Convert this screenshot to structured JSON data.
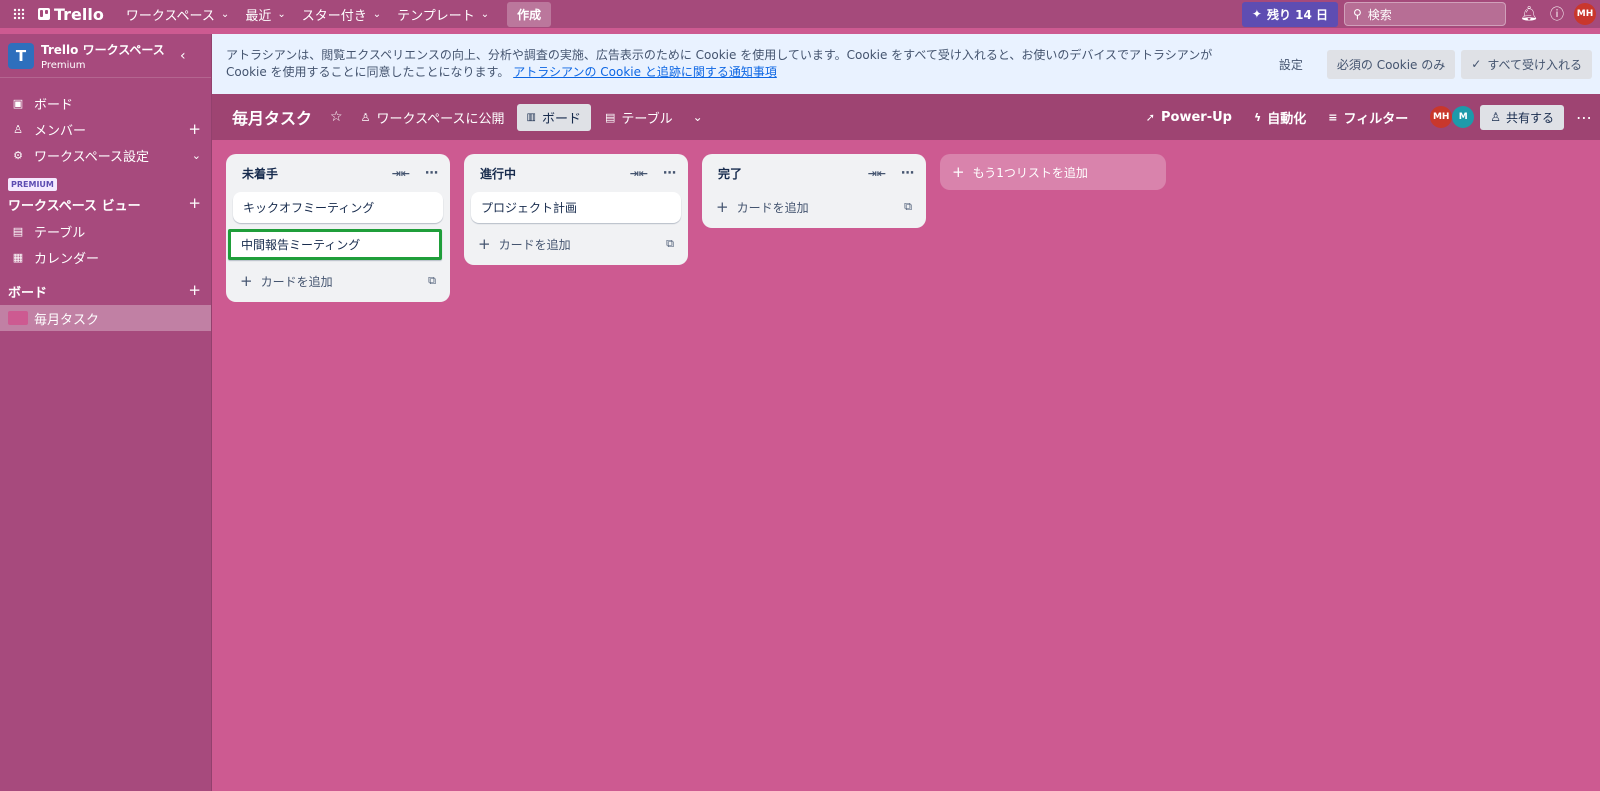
{
  "topbar": {
    "logo": "Trello",
    "menu": [
      {
        "label": "ワークスペース"
      },
      {
        "label": "最近"
      },
      {
        "label": "スター付き"
      },
      {
        "label": "テンプレート"
      }
    ],
    "create_label": "作成",
    "trial_label": "残り 14 日",
    "search_placeholder": "検索",
    "avatar_initials": "MH"
  },
  "sidebar": {
    "workspace_name": "Trello ワークスペース",
    "workspace_plan": "Premium",
    "workspace_initial": "T",
    "nav": [
      {
        "label": "ボード"
      },
      {
        "label": "メンバー"
      },
      {
        "label": "ワークスペース設定"
      }
    ],
    "premium_badge": "PREMIUM",
    "views_title": "ワークスペース ビュー",
    "views": [
      {
        "label": "テーブル"
      },
      {
        "label": "カレンダー"
      }
    ],
    "boards_title": "ボード",
    "boards": [
      {
        "label": "毎月タスク"
      }
    ]
  },
  "cookie": {
    "text": "アトラシアンは、閲覧エクスペリエンスの向上、分析や調査の実施、広告表示のために Cookie を使用しています。Cookie をすべて受け入れると、お使いのデバイスでアトラシアンが Cookie を使用することに同意したことになります。",
    "link": "アトラシアンの Cookie と追跡に関する通知事項",
    "settings_label": "設定",
    "necessary_label": "必須の Cookie のみ",
    "accept_all_label": "すべて受け入れる"
  },
  "board": {
    "title": "毎月タスク",
    "visibility": "ワークスペースに公開",
    "view_board": "ボード",
    "view_table": "テーブル",
    "powerup_label": "Power-Up",
    "automation_label": "自動化",
    "filter_label": "フィルター",
    "members": [
      {
        "initials": "MH",
        "color": "#c9372c"
      },
      {
        "initials": "M",
        "color": "#1d9aaa"
      }
    ],
    "share_label": "共有する",
    "add_list_label": "もう1つリストを追加",
    "lists": [
      {
        "title": "未着手",
        "cards": [
          "キックオフミーティング",
          "中間報告ミーティング"
        ],
        "add_card": "カードを追加"
      },
      {
        "title": "進行中",
        "cards": [
          "プロジェクト計画"
        ],
        "add_card": "カードを追加"
      },
      {
        "title": "完了",
        "cards": [],
        "add_card": "カードを追加"
      }
    ]
  },
  "colors": {
    "board_bg": "#cd5a91",
    "topbar_bg": "#a54a7b",
    "selected_card_border": "#1f9e3a"
  }
}
